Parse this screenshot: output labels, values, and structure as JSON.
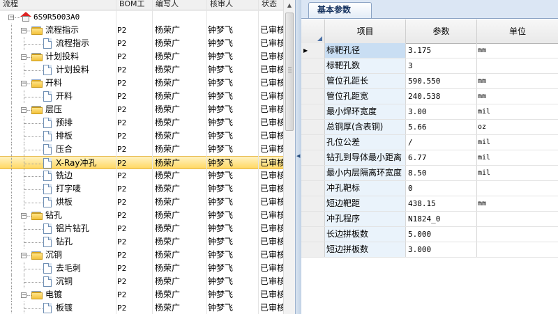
{
  "left_header": {
    "cols": [
      "流程",
      "BOM工",
      "编写人",
      "核审人",
      "状态"
    ]
  },
  "tree_root": "6S9R5003A0",
  "rows": [
    {
      "label": "流程指示",
      "level": 1,
      "type": "folder",
      "bom": "P2",
      "writer": "杨荣广",
      "reviewer": "钟梦飞",
      "status": "已审核"
    },
    {
      "label": "流程指示",
      "level": 2,
      "type": "doc",
      "bom": "P2",
      "writer": "杨荣广",
      "reviewer": "钟梦飞",
      "status": "已审核"
    },
    {
      "label": "计划投料",
      "level": 1,
      "type": "folder",
      "bom": "P2",
      "writer": "杨荣广",
      "reviewer": "钟梦飞",
      "status": "已审核"
    },
    {
      "label": "计划投料",
      "level": 2,
      "type": "doc",
      "bom": "P2",
      "writer": "杨荣广",
      "reviewer": "钟梦飞",
      "status": "已审核"
    },
    {
      "label": "开料",
      "level": 1,
      "type": "folder",
      "bom": "P2",
      "writer": "杨荣广",
      "reviewer": "钟梦飞",
      "status": "已审核"
    },
    {
      "label": "开料",
      "level": 2,
      "type": "doc",
      "bom": "P2",
      "writer": "杨荣广",
      "reviewer": "钟梦飞",
      "status": "已审核"
    },
    {
      "label": "层压",
      "level": 1,
      "type": "folder",
      "bom": "P2",
      "writer": "杨荣广",
      "reviewer": "钟梦飞",
      "status": "已审核"
    },
    {
      "label": "预排",
      "level": 2,
      "type": "doc",
      "bom": "P2",
      "writer": "杨荣广",
      "reviewer": "钟梦飞",
      "status": "已审核"
    },
    {
      "label": "排板",
      "level": 2,
      "type": "doc",
      "bom": "P2",
      "writer": "杨荣广",
      "reviewer": "钟梦飞",
      "status": "已审核"
    },
    {
      "label": "压合",
      "level": 2,
      "type": "doc",
      "bom": "P2",
      "writer": "杨荣广",
      "reviewer": "钟梦飞",
      "status": "已审核"
    },
    {
      "label": "X-Ray冲孔",
      "level": 2,
      "type": "doc",
      "bom": "P2",
      "writer": "杨荣广",
      "reviewer": "钟梦飞",
      "status": "已审核",
      "selected": true
    },
    {
      "label": "铣边",
      "level": 2,
      "type": "doc",
      "bom": "P2",
      "writer": "杨荣广",
      "reviewer": "钟梦飞",
      "status": "已审核"
    },
    {
      "label": "打字唛",
      "level": 2,
      "type": "doc",
      "bom": "P2",
      "writer": "杨荣广",
      "reviewer": "钟梦飞",
      "status": "已审核"
    },
    {
      "label": "烘板",
      "level": 2,
      "type": "doc",
      "bom": "P2",
      "writer": "杨荣广",
      "reviewer": "钟梦飞",
      "status": "已审核"
    },
    {
      "label": "钻孔",
      "level": 1,
      "type": "folder",
      "bom": "P2",
      "writer": "杨荣广",
      "reviewer": "钟梦飞",
      "status": "已审核"
    },
    {
      "label": "铝片钻孔",
      "level": 2,
      "type": "doc",
      "bom": "P2",
      "writer": "杨荣广",
      "reviewer": "钟梦飞",
      "status": "已审核"
    },
    {
      "label": "钻孔",
      "level": 2,
      "type": "doc",
      "bom": "P2",
      "writer": "杨荣广",
      "reviewer": "钟梦飞",
      "status": "已审核"
    },
    {
      "label": "沉铜",
      "level": 1,
      "type": "folder",
      "bom": "P2",
      "writer": "杨荣广",
      "reviewer": "钟梦飞",
      "status": "已审核"
    },
    {
      "label": "去毛刺",
      "level": 2,
      "type": "doc",
      "bom": "P2",
      "writer": "杨荣广",
      "reviewer": "钟梦飞",
      "status": "已审核"
    },
    {
      "label": "沉铜",
      "level": 2,
      "type": "doc",
      "bom": "P2",
      "writer": "杨荣广",
      "reviewer": "钟梦飞",
      "status": "已审核"
    },
    {
      "label": "电镀",
      "level": 1,
      "type": "folder",
      "bom": "P2",
      "writer": "杨荣广",
      "reviewer": "钟梦飞",
      "status": "已审核"
    },
    {
      "label": "板镀",
      "level": 2,
      "type": "doc",
      "bom": "P2",
      "writer": "杨荣广",
      "reviewer": "钟梦飞",
      "status": "已审核"
    }
  ],
  "right_panel": {
    "tab": "基本参数",
    "headers": [
      "项目",
      "参数",
      "单位"
    ],
    "params": [
      {
        "name": "标靶孔径",
        "value": "3.175",
        "unit": "mm",
        "current": true
      },
      {
        "name": "标靶孔数",
        "value": "3",
        "unit": ""
      },
      {
        "name": "管位孔距长",
        "value": "590.550",
        "unit": "mm"
      },
      {
        "name": "管位孔距宽",
        "value": "240.538",
        "unit": "mm"
      },
      {
        "name": "最小焊环宽度",
        "value": "3.00",
        "unit": "mil"
      },
      {
        "name": "总铜厚(含表铜)",
        "value": "5.66",
        "unit": "oz"
      },
      {
        "name": "孔位公差",
        "value": "/",
        "unit": "mil"
      },
      {
        "name": "钻孔到导体最小距离",
        "value": "6.77",
        "unit": "mil"
      },
      {
        "name": "最小内层隔离环宽度",
        "value": "8.50",
        "unit": "mil"
      },
      {
        "name": "冲孔靶标",
        "value": "0",
        "unit": ""
      },
      {
        "name": "短边靶距",
        "value": "438.15",
        "unit": "mm"
      },
      {
        "name": "冲孔程序",
        "value": "N1824_0",
        "unit": ""
      },
      {
        "name": "长边拼板数",
        "value": "5.000",
        "unit": ""
      },
      {
        "name": "短边拼板数",
        "value": "3.000",
        "unit": ""
      }
    ]
  }
}
